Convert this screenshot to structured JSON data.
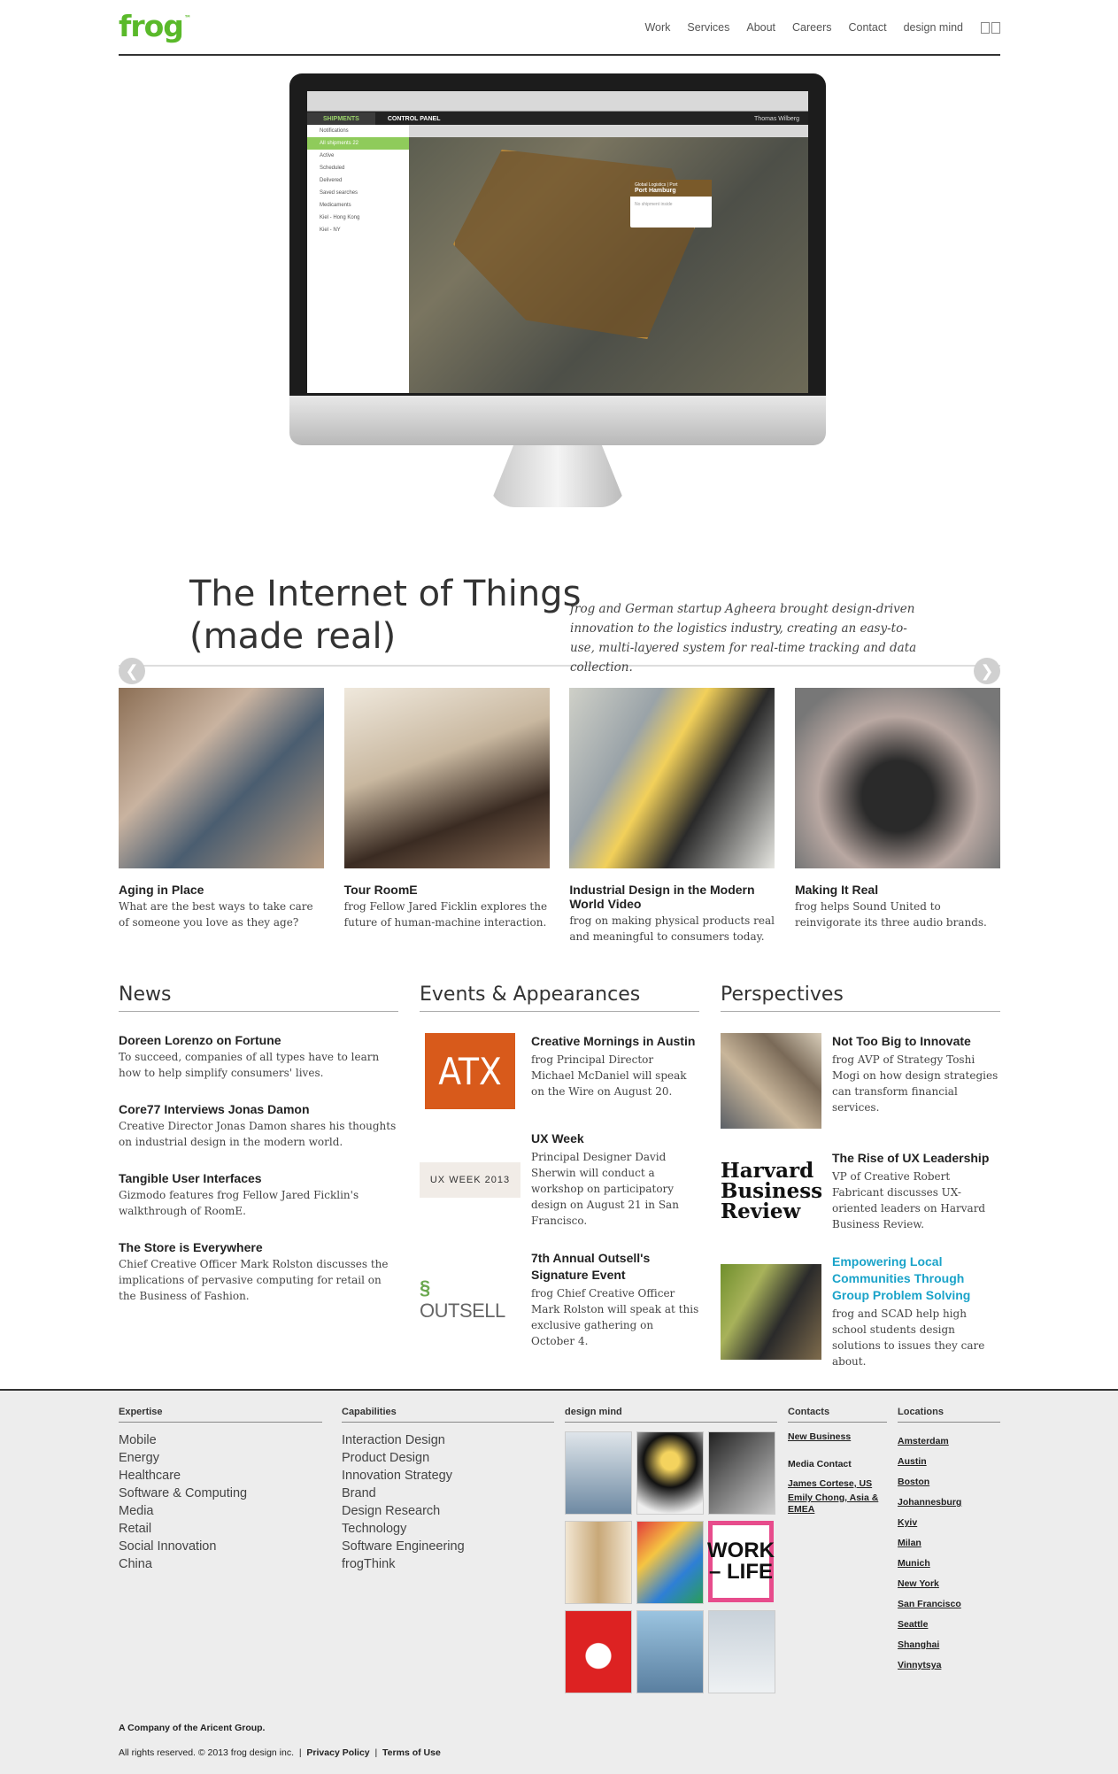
{
  "header": {
    "logo": "frog",
    "logo_tm": "™",
    "nav": [
      "Work",
      "Services",
      "About",
      "Careers",
      "Contact",
      "design mind"
    ]
  },
  "hero": {
    "screen": {
      "tab_shipments": "SHIPMENTS",
      "tab_control": "CONTROL PANEL",
      "user": "Thomas Wilberg",
      "sidebar": [
        "Notifications",
        "All shipments 22",
        "Active",
        "Scheduled",
        "Delivered",
        "Saved searches",
        "Medicaments",
        "Kiel - Hong Kong",
        "Kiel - NY"
      ],
      "popup_title": "Port Hamburg",
      "popup_sub": "Global Logistics | Port",
      "popup_body": "No shipment inside"
    },
    "title_line1": "The Internet of Things",
    "title_line2": "(made real)",
    "description": "frog and German startup Agheera brought design-driven innovation to the logistics industry, creating an easy-to-use, multi-layered system for real-time tracking and data collection."
  },
  "features": [
    {
      "title": "Aging in Place",
      "text": "What are the best ways to take care of someone you love as they age?"
    },
    {
      "title": "Tour RoomE",
      "text": "frog Fellow Jared Ficklin explores the future of human-machine interaction."
    },
    {
      "title": "Industrial Design in the Modern World Video",
      "text": "frog on making physical products real and meaningful to consumers today."
    },
    {
      "title": "Making It Real",
      "text": "frog helps Sound United to reinvigorate its three audio brands."
    }
  ],
  "news": {
    "heading": "News",
    "items": [
      {
        "title": "Doreen Lorenzo on Fortune",
        "text": "To succeed, companies of all types have to learn how to help simplify consumers' lives."
      },
      {
        "title": "Core77 Interviews Jonas Damon",
        "text": "Creative Director Jonas Damon shares his thoughts on industrial design in the modern world."
      },
      {
        "title": "Tangible User Interfaces",
        "text": "Gizmodo features frog Fellow Jared Ficklin's walkthrough of RoomE."
      },
      {
        "title": "The Store is Everywhere",
        "text": "Chief Creative Officer Mark Rolston discusses the implications of pervasive computing for retail on the Business of Fashion."
      }
    ]
  },
  "events": {
    "heading": "Events & Appearances",
    "items": [
      {
        "thumb": "ATX",
        "title": "Creative Mornings in Austin",
        "text": "frog Principal Director Michael McDaniel will speak on the Wire on August 20."
      },
      {
        "thumb": "UX WEEK 2013",
        "title": "UX Week",
        "text": "Principal Designer David Sherwin will conduct a workshop on participatory design on August 21 in San Francisco."
      },
      {
        "thumb": "OUTSELL",
        "title": "7th Annual Outsell's Signature Event",
        "text": "frog Chief Creative Officer Mark Rolston will speak at this exclusive gathering on October 4."
      }
    ]
  },
  "perspectives": {
    "heading": "Perspectives",
    "items": [
      {
        "title": "Not Too Big to Innovate",
        "text": "frog AVP of Strategy Toshi Mogi on how design strategies can transform financial services."
      },
      {
        "thumb": "Harvard Business Review",
        "title": "The Rise of UX Leadership",
        "text": "VP of Creative Robert Fabricant discusses UX-oriented leaders on Harvard Business Review."
      },
      {
        "title": "Empowering Local Communities Through Group Problem Solving",
        "text": "frog and SCAD help high school students design solutions to issues they care about."
      }
    ]
  },
  "footer": {
    "expertise": {
      "heading": "Expertise",
      "items": [
        "Mobile",
        "Energy",
        "Healthcare",
        "Software & Computing",
        "Media",
        "Retail",
        "Social Innovation",
        "China"
      ]
    },
    "capabilities": {
      "heading": "Capabilities",
      "items": [
        "Interaction Design",
        "Product Design",
        "Innovation Strategy",
        "Brand",
        "Design Research",
        "Technology",
        "Software Engineering",
        "frogThink"
      ]
    },
    "design_mind": {
      "heading": "design mind",
      "mag6_text": "WORK – LIFE"
    },
    "contacts": {
      "heading": "Contacts",
      "new_business": "New Business",
      "media_label": "Media Contact",
      "media_us": "James Cortese, US",
      "media_asia": "Emily Chong, Asia & EMEA"
    },
    "locations": {
      "heading": "Locations",
      "items": [
        "Amsterdam",
        "Austin",
        "Boston",
        "Johannesburg",
        "Kyiv",
        "Milan",
        "Munich",
        "New York",
        "San Francisco",
        "Seattle",
        "Shanghai",
        "Vinnytsya"
      ]
    },
    "company": "A Company of the Aricent Group.",
    "rights": "All rights reserved. © 2013 frog design inc.",
    "privacy": "Privacy Policy",
    "terms": "Terms of Use"
  }
}
